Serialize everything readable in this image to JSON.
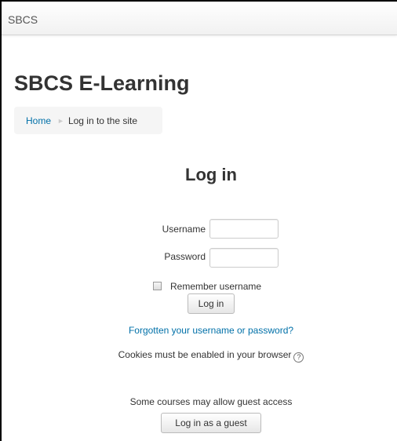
{
  "navbar": {
    "brand": "SBCS"
  },
  "header": {
    "site_title": "SBCS E-Learning"
  },
  "breadcrumb": {
    "home": "Home",
    "separator": "►",
    "current": "Log in to the site"
  },
  "login": {
    "title": "Log in",
    "username_label": "Username",
    "username_value": "",
    "password_label": "Password",
    "password_value": "",
    "remember_label": "Remember username",
    "remember_checked": false,
    "submit_label": "Log in",
    "forgot_link": "Forgotten your username or password?",
    "cookies_notice": "Cookies must be enabled in your browser",
    "help_icon": "question-circle-icon"
  },
  "guest": {
    "notice": "Some courses may allow guest access",
    "button_label": "Log in as a guest"
  },
  "colors": {
    "link": "#0070a8",
    "text": "#333333",
    "breadcrumb_bg": "#f5f5f5"
  }
}
